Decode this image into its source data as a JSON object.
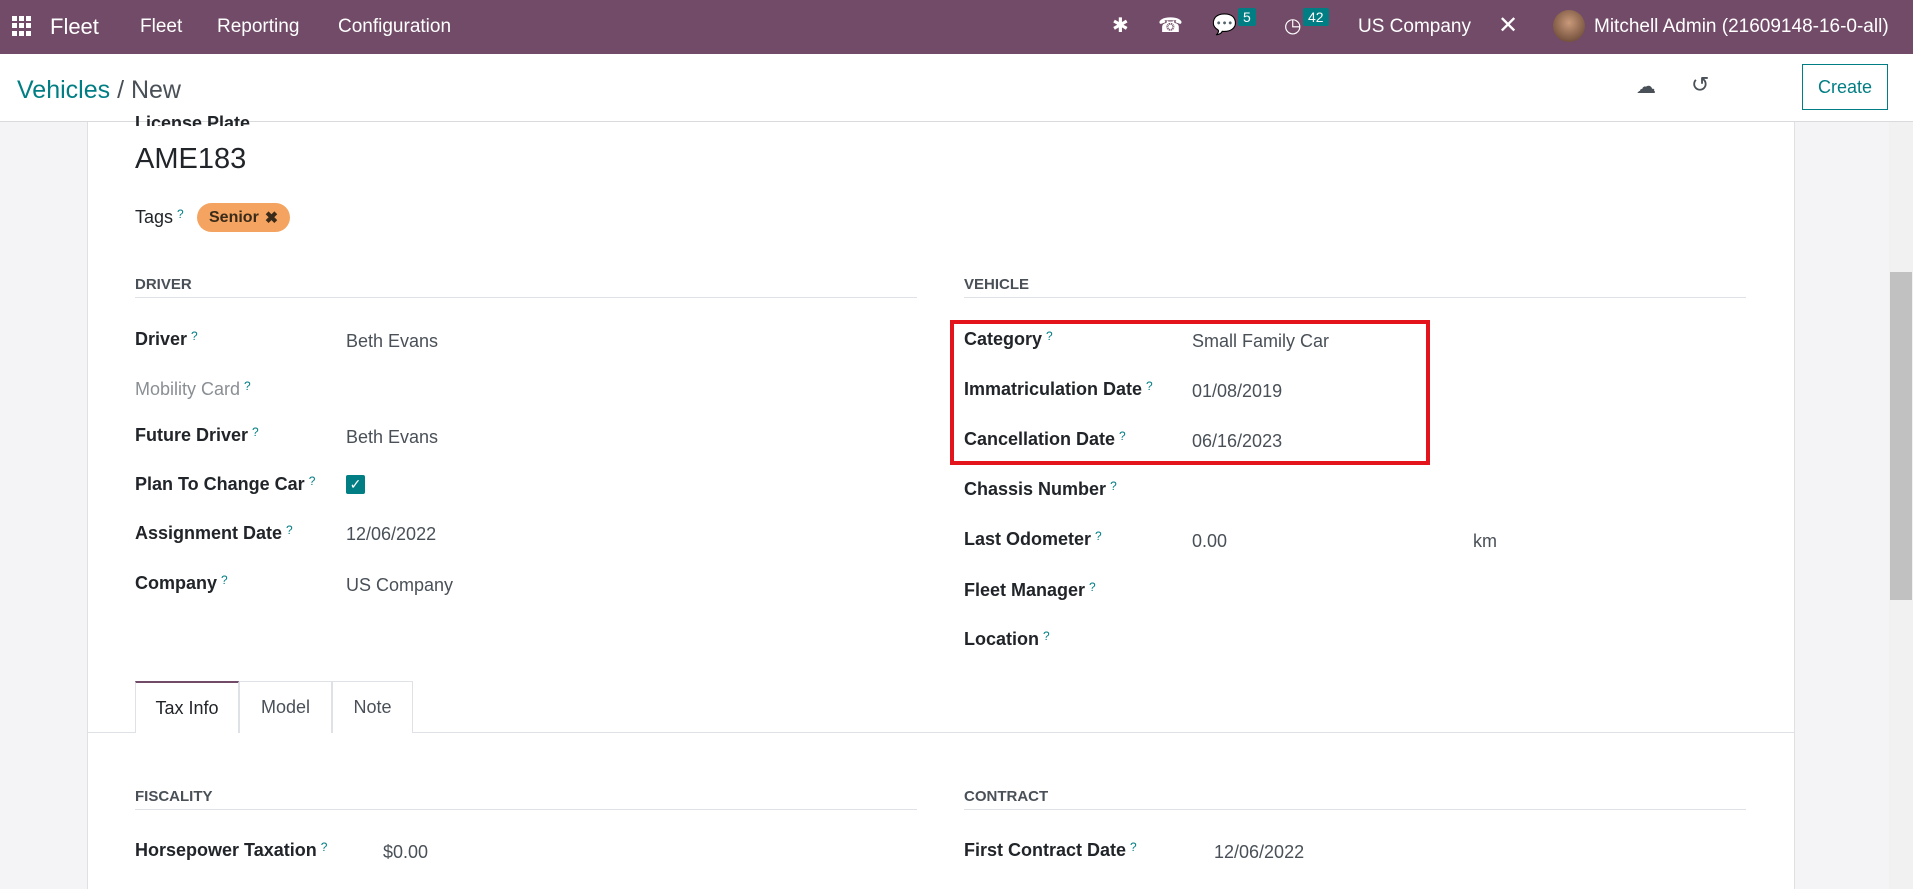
{
  "navbar": {
    "app": "Fleet",
    "menus": [
      "Fleet",
      "Reporting",
      "Configuration"
    ],
    "messages_count": "5",
    "activities_count": "42",
    "company": "US Company",
    "user": "Mitchell Admin (21609148-16-0-all)"
  },
  "control": {
    "breadcrumb_parent": "Vehicles",
    "breadcrumb_current": "New",
    "create_label": "Create"
  },
  "form": {
    "license_plate_label": "License Plate",
    "license_plate": "AME183",
    "tags_label": "Tags",
    "tags": [
      "Senior"
    ],
    "driver_section": {
      "title": "DRIVER",
      "driver_label": "Driver",
      "driver": "Beth Evans",
      "mobility_card_label": "Mobility Card",
      "future_driver_label": "Future Driver",
      "future_driver": "Beth Evans",
      "plan_change_label": "Plan To Change Car",
      "plan_change": true,
      "assignment_date_label": "Assignment Date",
      "assignment_date": "12/06/2022",
      "company_label": "Company",
      "company": "US Company"
    },
    "vehicle_section": {
      "title": "VEHICLE",
      "category_label": "Category",
      "category": "Small Family Car",
      "immat_label": "Immatriculation Date",
      "immat": "01/08/2019",
      "cancel_label": "Cancellation Date",
      "cancel": "06/16/2023",
      "chassis_label": "Chassis Number",
      "odometer_label": "Last Odometer",
      "odometer": "0.00",
      "odometer_unit": "km",
      "manager_label": "Fleet Manager",
      "location_label": "Location"
    },
    "tabs": [
      "Tax Info",
      "Model",
      "Note"
    ],
    "fiscality": {
      "title": "FISCALITY",
      "horsepower_label": "Horsepower Taxation",
      "horsepower": "$0.00"
    },
    "contract": {
      "title": "CONTRACT",
      "first_contract_label": "First Contract Date",
      "first_contract": "12/06/2022"
    }
  },
  "colors": {
    "navbar": "#714b67",
    "accent": "#017e84",
    "tag": "#f4a460",
    "highlight": "#e3141c"
  }
}
